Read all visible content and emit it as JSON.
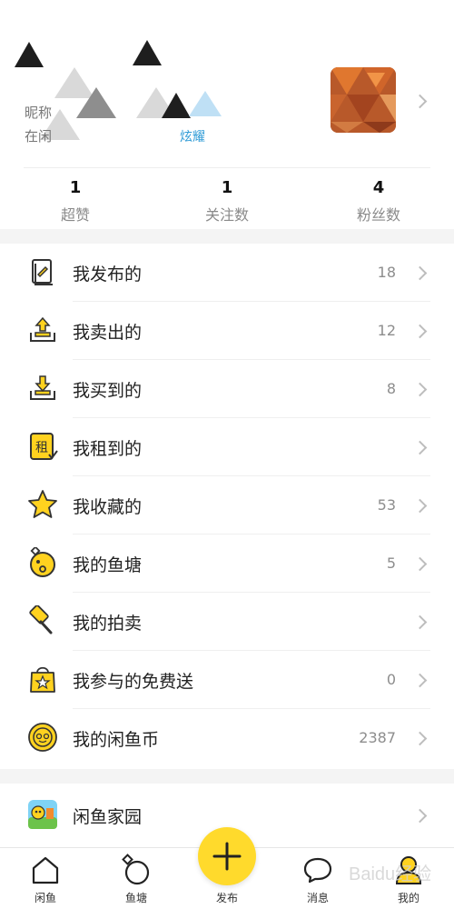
{
  "profile": {
    "line1": "昵称",
    "line2": "在闲",
    "link_text": "炫耀",
    "stats": [
      {
        "value": "1",
        "label": "超赞"
      },
      {
        "value": "1",
        "label": "关注数"
      },
      {
        "value": "4",
        "label": "粉丝数"
      }
    ]
  },
  "menu": {
    "items": [
      {
        "label": "我发布的",
        "count": "18",
        "icon": "published-icon"
      },
      {
        "label": "我卖出的",
        "count": "12",
        "icon": "sold-icon"
      },
      {
        "label": "我买到的",
        "count": "8",
        "icon": "bought-icon"
      },
      {
        "label": "我租到的",
        "count": "",
        "icon": "rent-icon",
        "icon_text": "租"
      },
      {
        "label": "我收藏的",
        "count": "53",
        "icon": "star-icon"
      },
      {
        "label": "我的鱼塘",
        "count": "5",
        "icon": "fishpond-icon"
      },
      {
        "label": "我的拍卖",
        "count": "",
        "icon": "auction-hammer-icon"
      },
      {
        "label": "我参与的免费送",
        "count": "0",
        "icon": "free-gift-icon"
      },
      {
        "label": "我的闲鱼币",
        "count": "2387",
        "icon": "coin-icon"
      }
    ],
    "home": {
      "label": "闲鱼家园",
      "icon": "home-garden-icon"
    }
  },
  "tabbar": {
    "tabs": [
      {
        "label": "闲鱼",
        "icon": "home-icon"
      },
      {
        "label": "鱼塘",
        "icon": "fishpond-tab-icon"
      },
      {
        "label": "发布",
        "icon": "plus-icon"
      },
      {
        "label": "消息",
        "icon": "message-icon"
      },
      {
        "label": "我的",
        "icon": "profile-icon"
      }
    ]
  },
  "watermark": "Baidu经验",
  "colors": {
    "accent": "#ffda2c",
    "link": "#2f9bd6",
    "icon_yellow": "#ffd21f"
  }
}
